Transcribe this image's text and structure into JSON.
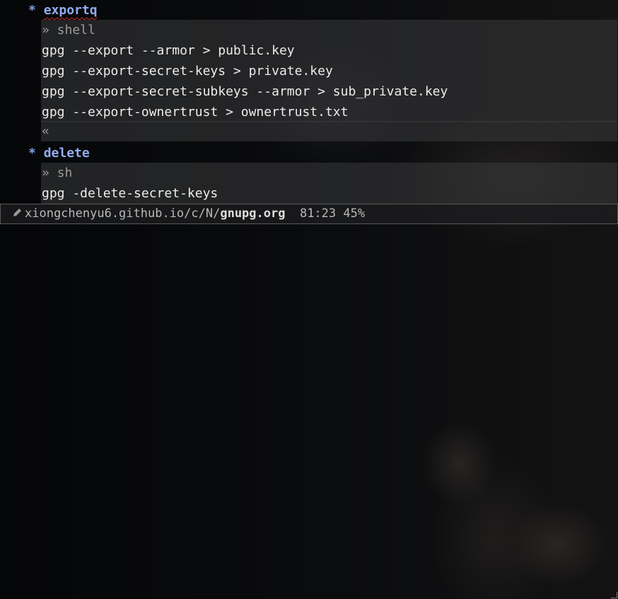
{
  "buffer": {
    "headings": [
      {
        "star": "*",
        "title": "exportq"
      },
      {
        "star": "*",
        "title": "delete"
      }
    ],
    "block1": {
      "begin": "» shell",
      "lines": [
        "gpg --export --armor > public.key",
        "gpg --export-secret-keys > private.key",
        "gpg --export-secret-subkeys --armor > sub_private.key",
        "gpg --export-ownertrust > ownertrust.txt"
      ],
      "end": "«"
    },
    "block2": {
      "begin": "» sh",
      "lines": [
        "gpg -delete-secret-keys"
      ]
    }
  },
  "modeline": {
    "icon": "edit-pen-icon",
    "path": "xiongchenyu6.github.io/c/N/",
    "filename": "gnupg.org",
    "position": "81:23",
    "percent": "45%"
  },
  "colors": {
    "heading": "#92acf0",
    "star": "#7fa2e6",
    "block_bg": "#3a3a3c"
  }
}
